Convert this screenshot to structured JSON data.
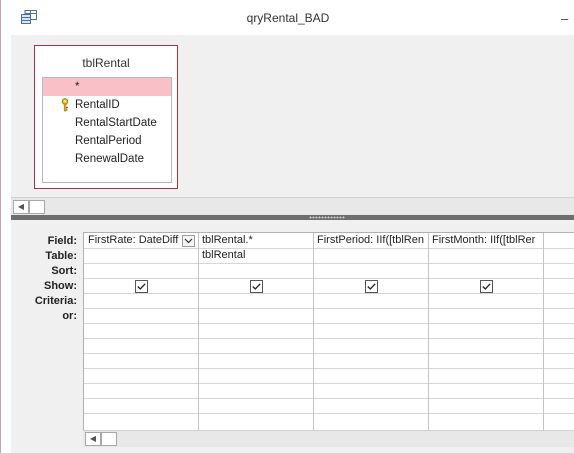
{
  "window": {
    "title": "qryRental_BAD",
    "minimize_label": "–"
  },
  "table": {
    "name": "tblRental",
    "fields": [
      "*",
      "RentalID",
      "RentalStartDate",
      "RentalPeriod",
      "RenewalDate"
    ],
    "key_field": "RentalID"
  },
  "grid": {
    "row_labels": [
      "Field:",
      "Table:",
      "Sort:",
      "Show:",
      "Criteria:",
      "or:"
    ],
    "columns": [
      {
        "field": "FirstRate: DateDiff",
        "table": "",
        "show": true
      },
      {
        "field": "tblRental.*",
        "table": "tblRental",
        "show": true
      },
      {
        "field": "FirstPeriod: IIf([tblRen",
        "table": "",
        "show": true
      },
      {
        "field": "FirstMonth: IIf([tblRer",
        "table": "",
        "show": true
      },
      {
        "field": "",
        "table": "",
        "show": false
      }
    ]
  },
  "colors": {
    "selected_field": "#f9c0c8",
    "table_border": "#a0344a",
    "splitter": "#6e6e6e"
  }
}
